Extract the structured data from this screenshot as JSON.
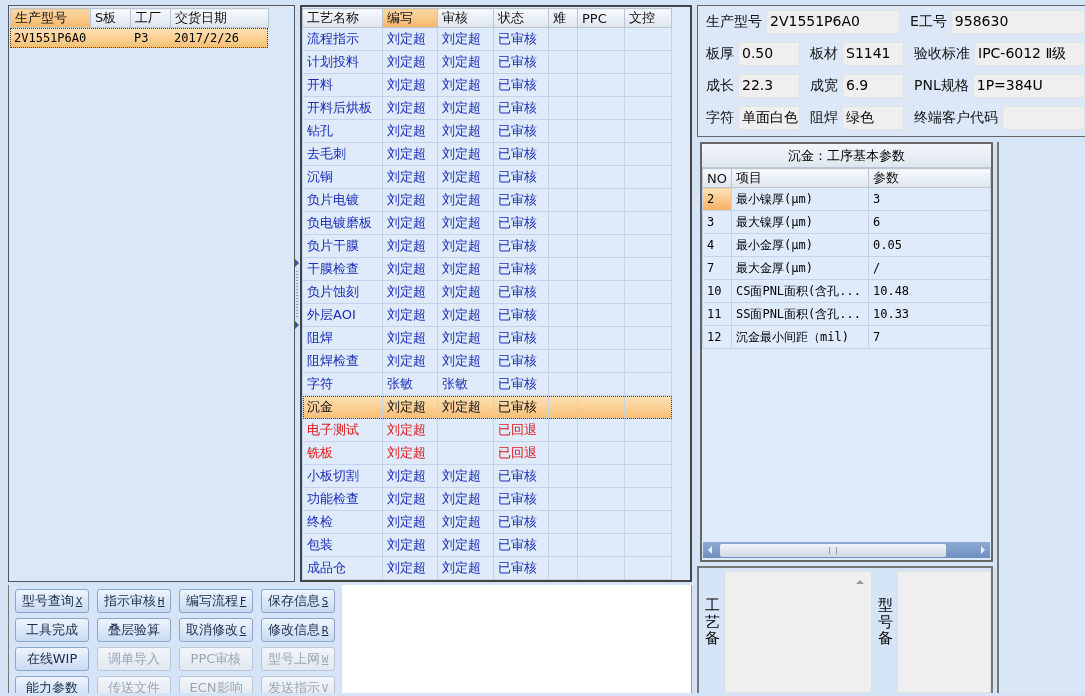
{
  "product_list": {
    "columns": [
      {
        "label": "生产型号",
        "sorted": true
      },
      {
        "label": "S板",
        "sorted": false
      },
      {
        "label": "工厂",
        "sorted": false
      },
      {
        "label": "交货日期",
        "sorted": false
      }
    ],
    "rows": [
      {
        "model": "2V1551P6A0",
        "factory": "P3",
        "delivery_date": "2017/2/26",
        "selected": true
      }
    ]
  },
  "process_table": {
    "columns": [
      {
        "label": "工艺名称",
        "sorted": false
      },
      {
        "label": "编写",
        "sorted": true
      },
      {
        "label": "审核",
        "sorted": false
      },
      {
        "label": "状态",
        "sorted": false
      },
      {
        "label": "难",
        "sorted": false
      },
      {
        "label": "PPC",
        "sorted": false
      },
      {
        "label": "文控",
        "sorted": false
      }
    ],
    "rows": [
      {
        "name": "流程指示",
        "writer": "刘定超",
        "reviewer": "刘定超",
        "status": "已审核",
        "kind": "approved",
        "selected": false
      },
      {
        "name": "计划投料",
        "writer": "刘定超",
        "reviewer": "刘定超",
        "status": "已审核",
        "kind": "approved",
        "selected": false
      },
      {
        "name": "开料",
        "writer": "刘定超",
        "reviewer": "刘定超",
        "status": "已审核",
        "kind": "approved",
        "selected": false
      },
      {
        "name": "开料后烘板",
        "writer": "刘定超",
        "reviewer": "刘定超",
        "status": "已审核",
        "kind": "approved",
        "selected": false
      },
      {
        "name": "钻孔",
        "writer": "刘定超",
        "reviewer": "刘定超",
        "status": "已审核",
        "kind": "approved",
        "selected": false
      },
      {
        "name": "去毛刺",
        "writer": "刘定超",
        "reviewer": "刘定超",
        "status": "已审核",
        "kind": "approved",
        "selected": false
      },
      {
        "name": "沉铜",
        "writer": "刘定超",
        "reviewer": "刘定超",
        "status": "已审核",
        "kind": "approved",
        "selected": false
      },
      {
        "name": "负片电镀",
        "writer": "刘定超",
        "reviewer": "刘定超",
        "status": "已审核",
        "kind": "approved",
        "selected": false
      },
      {
        "name": "负电镀磨板",
        "writer": "刘定超",
        "reviewer": "刘定超",
        "status": "已审核",
        "kind": "approved",
        "selected": false
      },
      {
        "name": "负片干膜",
        "writer": "刘定超",
        "reviewer": "刘定超",
        "status": "已审核",
        "kind": "approved",
        "selected": false
      },
      {
        "name": "干膜检查",
        "writer": "刘定超",
        "reviewer": "刘定超",
        "status": "已审核",
        "kind": "approved",
        "selected": false
      },
      {
        "name": "负片蚀刻",
        "writer": "刘定超",
        "reviewer": "刘定超",
        "status": "已审核",
        "kind": "approved",
        "selected": false
      },
      {
        "name": "外层AOI",
        "writer": "刘定超",
        "reviewer": "刘定超",
        "status": "已审核",
        "kind": "approved",
        "selected": false
      },
      {
        "name": "阻焊",
        "writer": "刘定超",
        "reviewer": "刘定超",
        "status": "已审核",
        "kind": "approved",
        "selected": false
      },
      {
        "name": "阻焊检查",
        "writer": "刘定超",
        "reviewer": "刘定超",
        "status": "已审核",
        "kind": "approved",
        "selected": false
      },
      {
        "name": "字符",
        "writer": "张敏",
        "reviewer": "张敏",
        "status": "已审核",
        "kind": "approved",
        "selected": false
      },
      {
        "name": "沉金",
        "writer": "刘定超",
        "reviewer": "刘定超",
        "status": "已审核",
        "kind": "approved",
        "selected": true
      },
      {
        "name": "电子测试",
        "writer": "刘定超",
        "status": "已回退",
        "kind": "returned",
        "selected": false
      },
      {
        "name": "铣板",
        "writer": "刘定超",
        "status": "已回退",
        "kind": "returned",
        "selected": false
      },
      {
        "name": "小板切割",
        "writer": "刘定超",
        "reviewer": "刘定超",
        "status": "已审核",
        "kind": "approved",
        "selected": false
      },
      {
        "name": "功能检查",
        "writer": "刘定超",
        "reviewer": "刘定超",
        "status": "已审核",
        "kind": "approved",
        "selected": false
      },
      {
        "name": "终检",
        "writer": "刘定超",
        "reviewer": "刘定超",
        "status": "已审核",
        "kind": "approved",
        "selected": false
      },
      {
        "name": "包装",
        "writer": "刘定超",
        "reviewer": "刘定超",
        "status": "已审核",
        "kind": "approved",
        "selected": false
      },
      {
        "name": "成品仓",
        "writer": "刘定超",
        "reviewer": "刘定超",
        "status": "已审核",
        "kind": "approved",
        "selected": false
      }
    ]
  },
  "info_form": [
    [
      {
        "label": "生产型号",
        "value": "2V1551P6A0"
      },
      {
        "label": "E工号",
        "value": "958630"
      }
    ],
    [
      {
        "label": "板厚",
        "value": "0.50"
      },
      {
        "label": "板材",
        "value": "S1141"
      },
      {
        "label": "验收标准",
        "value": "IPC-6012 Ⅱ级"
      }
    ],
    [
      {
        "label": "成长",
        "value": "22.3"
      },
      {
        "label": "成宽",
        "value": "6.9"
      },
      {
        "label": "PNL规格",
        "value": "1P=384U"
      }
    ],
    [
      {
        "label": "字符",
        "value": "单面白色"
      },
      {
        "label": "阻焊",
        "value": "绿色"
      },
      {
        "label": "终端客户代码"
      }
    ]
  ],
  "params": {
    "title": "沉金：工序基本参数",
    "columns": [
      "NO",
      "项目",
      "参数"
    ],
    "rows": [
      {
        "no": "2",
        "item": "最小镍厚(μm)",
        "value": "3",
        "selected": true
      },
      {
        "no": "3",
        "item": "最大镍厚(μm)",
        "value": "6",
        "selected": false
      },
      {
        "no": "4",
        "item": "最小金厚(μm)",
        "value": "0.05",
        "selected": false
      },
      {
        "no": "7",
        "item": "最大金厚(μm)",
        "value": "/",
        "selected": false
      },
      {
        "no": "10",
        "item": "CS面PNL面积(含孔...",
        "value": "10.48",
        "selected": false
      },
      {
        "no": "11",
        "item": "SS面PNL面积(含孔...",
        "value": "10.33",
        "selected": false
      },
      {
        "no": "12",
        "item": "沉金最小间距（mil)",
        "value": "7",
        "selected": false
      }
    ]
  },
  "buttons": [
    {
      "label": "型号查询",
      "shortcut": "X",
      "disabled": false
    },
    {
      "label": "指示审核",
      "shortcut": "H",
      "disabled": false
    },
    {
      "label": "编写流程",
      "shortcut": "F",
      "disabled": false
    },
    {
      "label": "保存信息",
      "shortcut": "S",
      "disabled": false
    },
    {
      "label": "工具完成",
      "disabled": false
    },
    {
      "label": "叠层验算",
      "disabled": false
    },
    {
      "label": "取消修改",
      "shortcut": "C",
      "disabled": false
    },
    {
      "label": "修改信息",
      "shortcut": "R",
      "disabled": false
    },
    {
      "label": "在线WIP",
      "disabled": false
    },
    {
      "label": "调单导入",
      "disabled": true
    },
    {
      "label": "PPC审核",
      "disabled": true
    },
    {
      "label": "型号上网",
      "shortcut": "W",
      "disabled": true
    },
    {
      "label": "能力参数",
      "disabled": false
    },
    {
      "label": "传送文件",
      "disabled": true
    },
    {
      "label": "ECN影响",
      "disabled": true
    },
    {
      "label": "发送指示",
      "shortcut": "V",
      "disabled": true
    }
  ],
  "remarks": [
    {
      "label": "工艺备",
      "scrollbar": true
    },
    {
      "label": "型号备",
      "scrollbar": false
    }
  ]
}
